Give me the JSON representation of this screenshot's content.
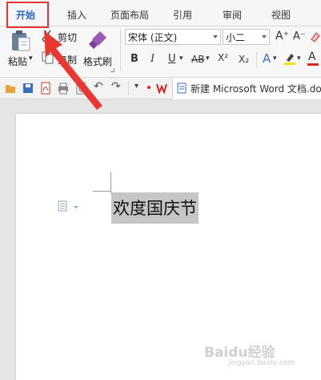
{
  "tabs": [
    {
      "label": "开始",
      "active": true
    },
    {
      "label": "插入",
      "active": false
    },
    {
      "label": "页面布局",
      "active": false
    },
    {
      "label": "引用",
      "active": false
    },
    {
      "label": "审阅",
      "active": false
    },
    {
      "label": "视图",
      "active": false
    }
  ],
  "clipboard": {
    "paste_label": "粘贴",
    "cut_label": "剪切",
    "copy_label": "复制",
    "format_painter_label": "格式刷"
  },
  "font": {
    "family_value": "宋体 (正文)",
    "size_value": "小二",
    "grow_label": "A⁺",
    "shrink_label": "A⁻",
    "bold": "B",
    "italic": "I",
    "underline": "U",
    "strike": "AB",
    "superscript": "X²",
    "subscript": "X₂",
    "text_effect": "A",
    "font_color": "A"
  },
  "quick_access": {
    "icons": [
      "open-icon",
      "save-icon",
      "pdf-export-icon",
      "print-icon",
      "print-preview-icon",
      "undo-icon",
      "redo-icon",
      "customize-icon"
    ]
  },
  "document_tab": {
    "title": "新建 Microsoft Word 文档.do"
  },
  "document": {
    "selected_text": "欢度国庆节"
  },
  "watermark": {
    "main": "Baidu经验",
    "sub": "jingyan.baidu.com"
  },
  "colors": {
    "accent": "#2a64c5",
    "highlight_border": "#e53333",
    "selection": "#c6c6c6",
    "wps_red": "#d9261c"
  }
}
